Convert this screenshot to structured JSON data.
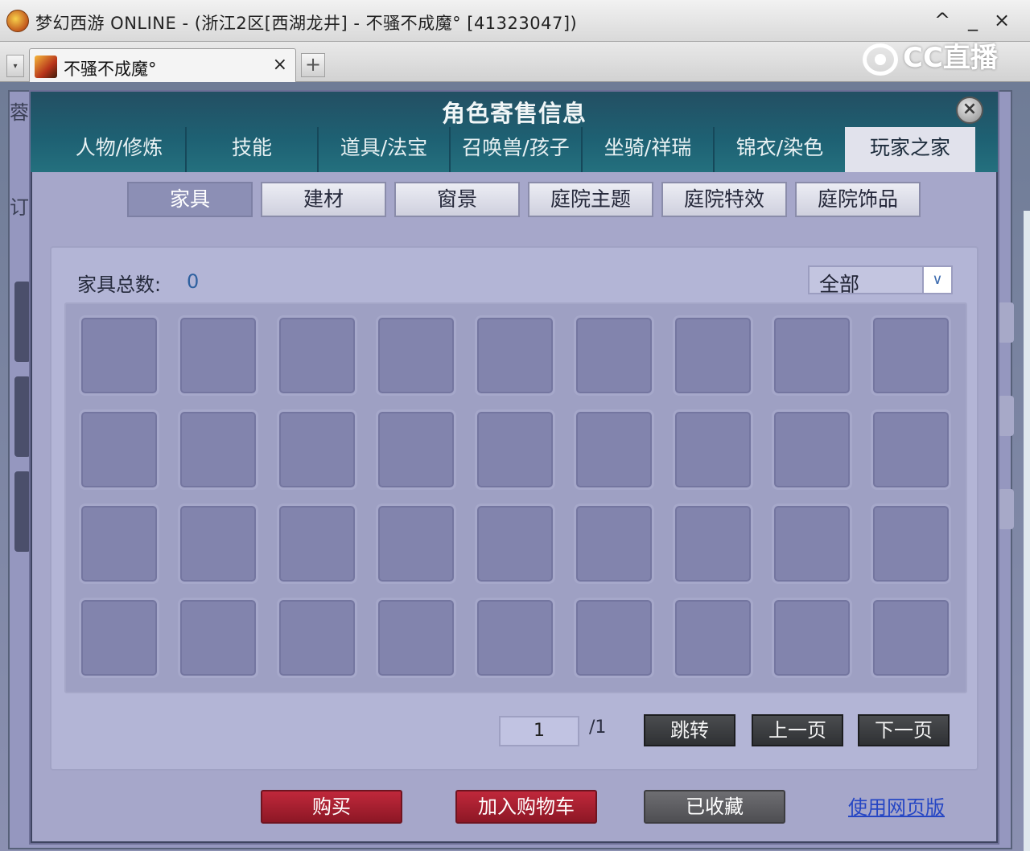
{
  "window": {
    "title": "梦幻西游 ONLINE - (浙江2区[西湖龙井] - 不骚不成魔° [41323047])",
    "controls": {
      "collapse": "^",
      "minimize": "_",
      "close": "×"
    }
  },
  "tab_bar": {
    "menu_glyph": "▾",
    "active_tab": {
      "title": "不骚不成魔°",
      "close": "×"
    },
    "add_tab": "+"
  },
  "watermark": {
    "text": "CC直播"
  },
  "background": {
    "left_text_1": "蓉",
    "left_text_2": "订"
  },
  "dialog": {
    "title": "角色寄售信息",
    "close": "×",
    "main_tabs": [
      {
        "label": "人物/修炼",
        "active": false
      },
      {
        "label": "技能",
        "active": false
      },
      {
        "label": "道具/法宝",
        "active": false
      },
      {
        "label": "召唤兽/孩子",
        "active": false
      },
      {
        "label": "坐骑/祥瑞",
        "active": false
      },
      {
        "label": "锦衣/染色",
        "active": false
      },
      {
        "label": "玩家之家",
        "active": true
      }
    ],
    "sub_tabs": [
      {
        "label": "家具",
        "active": true
      },
      {
        "label": "建材",
        "active": false
      },
      {
        "label": "窗景",
        "active": false
      },
      {
        "label": "庭院主题",
        "active": false
      },
      {
        "label": "庭院特效",
        "active": false
      },
      {
        "label": "庭院饰品",
        "active": false
      }
    ],
    "count_label": "家具总数:",
    "count_value": "0",
    "filter": {
      "value": "全部",
      "arrow_icon": "chevron-down-icon"
    },
    "grid": {
      "rows": 4,
      "cols": 9
    },
    "pagination": {
      "current_page": "1",
      "total": "/1",
      "jump": "跳转",
      "prev": "上一页",
      "next": "下一页"
    },
    "actions": {
      "buy": "购买",
      "add_cart": "加入购物车",
      "favorited": "已收藏",
      "web_version": "使用网页版"
    }
  },
  "colors": {
    "header_teal": "#1e6173",
    "panel": "#b3b5d6",
    "slot": "#8284ad",
    "red_button": "#a81f30",
    "link": "#2546c4"
  }
}
